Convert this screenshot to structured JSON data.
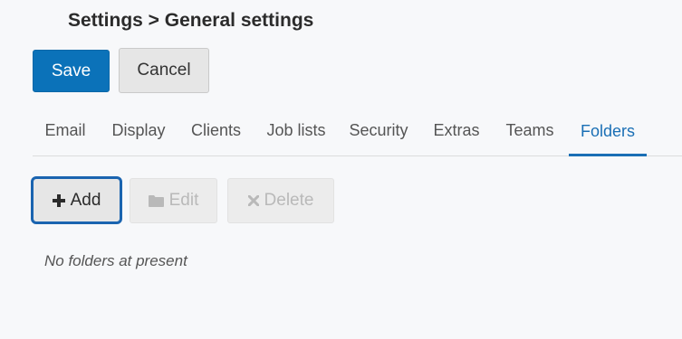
{
  "header": {
    "title": "Settings > General settings"
  },
  "actions": {
    "save_label": "Save",
    "cancel_label": "Cancel"
  },
  "tabs": [
    {
      "label": "Email",
      "active": false
    },
    {
      "label": "Display",
      "active": false
    },
    {
      "label": "Clients",
      "active": false
    },
    {
      "label": "Job lists",
      "active": false
    },
    {
      "label": "Security",
      "active": false
    },
    {
      "label": "Extras",
      "active": false
    },
    {
      "label": "Teams",
      "active": false
    },
    {
      "label": "Folders",
      "active": true
    }
  ],
  "folders": {
    "add_label": "Add",
    "edit_label": "Edit",
    "delete_label": "Delete",
    "add_icon": "plus-icon",
    "edit_icon": "folder-icon",
    "delete_icon": "close-icon",
    "empty_message": "No folders at present"
  },
  "colors": {
    "primary": "#0b72b9",
    "active_tab": "#1a6fb5",
    "focus_outline": "#1a64b0",
    "background": "#f7f8fa"
  }
}
